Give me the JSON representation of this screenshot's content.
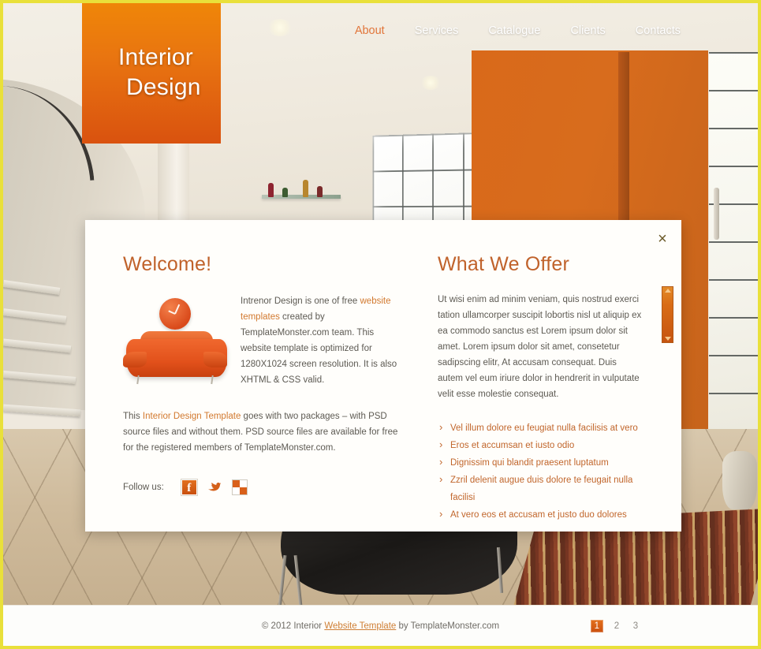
{
  "site": {
    "logo_line1": "Interior",
    "logo_line2": "Design"
  },
  "nav": {
    "items": [
      {
        "label": "About",
        "active": true
      },
      {
        "label": "Services",
        "active": false
      },
      {
        "label": "Catalogue",
        "active": false
      },
      {
        "label": "Clients",
        "active": false
      },
      {
        "label": "Contacts",
        "active": false
      }
    ]
  },
  "panel": {
    "close_icon": "close-icon",
    "close_glyph": "×",
    "left": {
      "title": "Welcome!",
      "intro_paragraph": {
        "before_link": "Intrenor Design is one of free ",
        "link": "website templates",
        "after_link": " created by TemplateMonster.com team. This website template is optimized for 1280X1024 screen resolution. It is also XHTML & CSS valid."
      },
      "second_paragraph": {
        "before_link": "This ",
        "link": "Interior Design Template",
        "after_link": " goes with two packages – with PSD source files and without them. PSD source files are available for free for the registered members of TemplateMonster.com."
      },
      "follow_label": "Follow us:",
      "social": [
        {
          "name": "facebook-icon",
          "glyph": "f"
        },
        {
          "name": "twitter-icon",
          "glyph": ""
        },
        {
          "name": "delicious-icon",
          "glyph": ""
        }
      ]
    },
    "right": {
      "title": "What We Offer",
      "paragraph": "Ut wisi enim ad minim veniam, quis nostrud exerci tation ullamcorper suscipit lobortis nisl ut aliquip ex ea commodo sanctus est Lorem ipsum dolor sit amet. Lorem ipsum dolor sit amet, consetetur sadipscing elitr, At accusam consequat. Duis autem vel eum iriure dolor in hendrerit in vulputate velit esse molestie consequat.",
      "list": [
        "Vel illum dolore eu feugiat nulla facilisis at vero",
        "Eros et accumsan et iusto odio",
        "Dignissim qui blandit praesent luptatum",
        "Zzril delenit augue duis dolore te feugait nulla facilisi",
        "At vero eos et accusam et justo duo dolores"
      ]
    }
  },
  "footer": {
    "copyright_before": "© 2012 Interior ",
    "copyright_link": "Website Template",
    "copyright_after": " by TemplateMonster.com",
    "pages": [
      {
        "label": "1",
        "active": true
      },
      {
        "label": "2",
        "active": false
      },
      {
        "label": "3",
        "active": false
      }
    ]
  },
  "colors": {
    "accent_orange": "#d9601a",
    "heading_orange": "#c0622b",
    "link_orange": "#d2792f",
    "body_text": "#5d5a53",
    "frame_yellow": "#e9e03a",
    "panel_bg": "#fffefb"
  }
}
